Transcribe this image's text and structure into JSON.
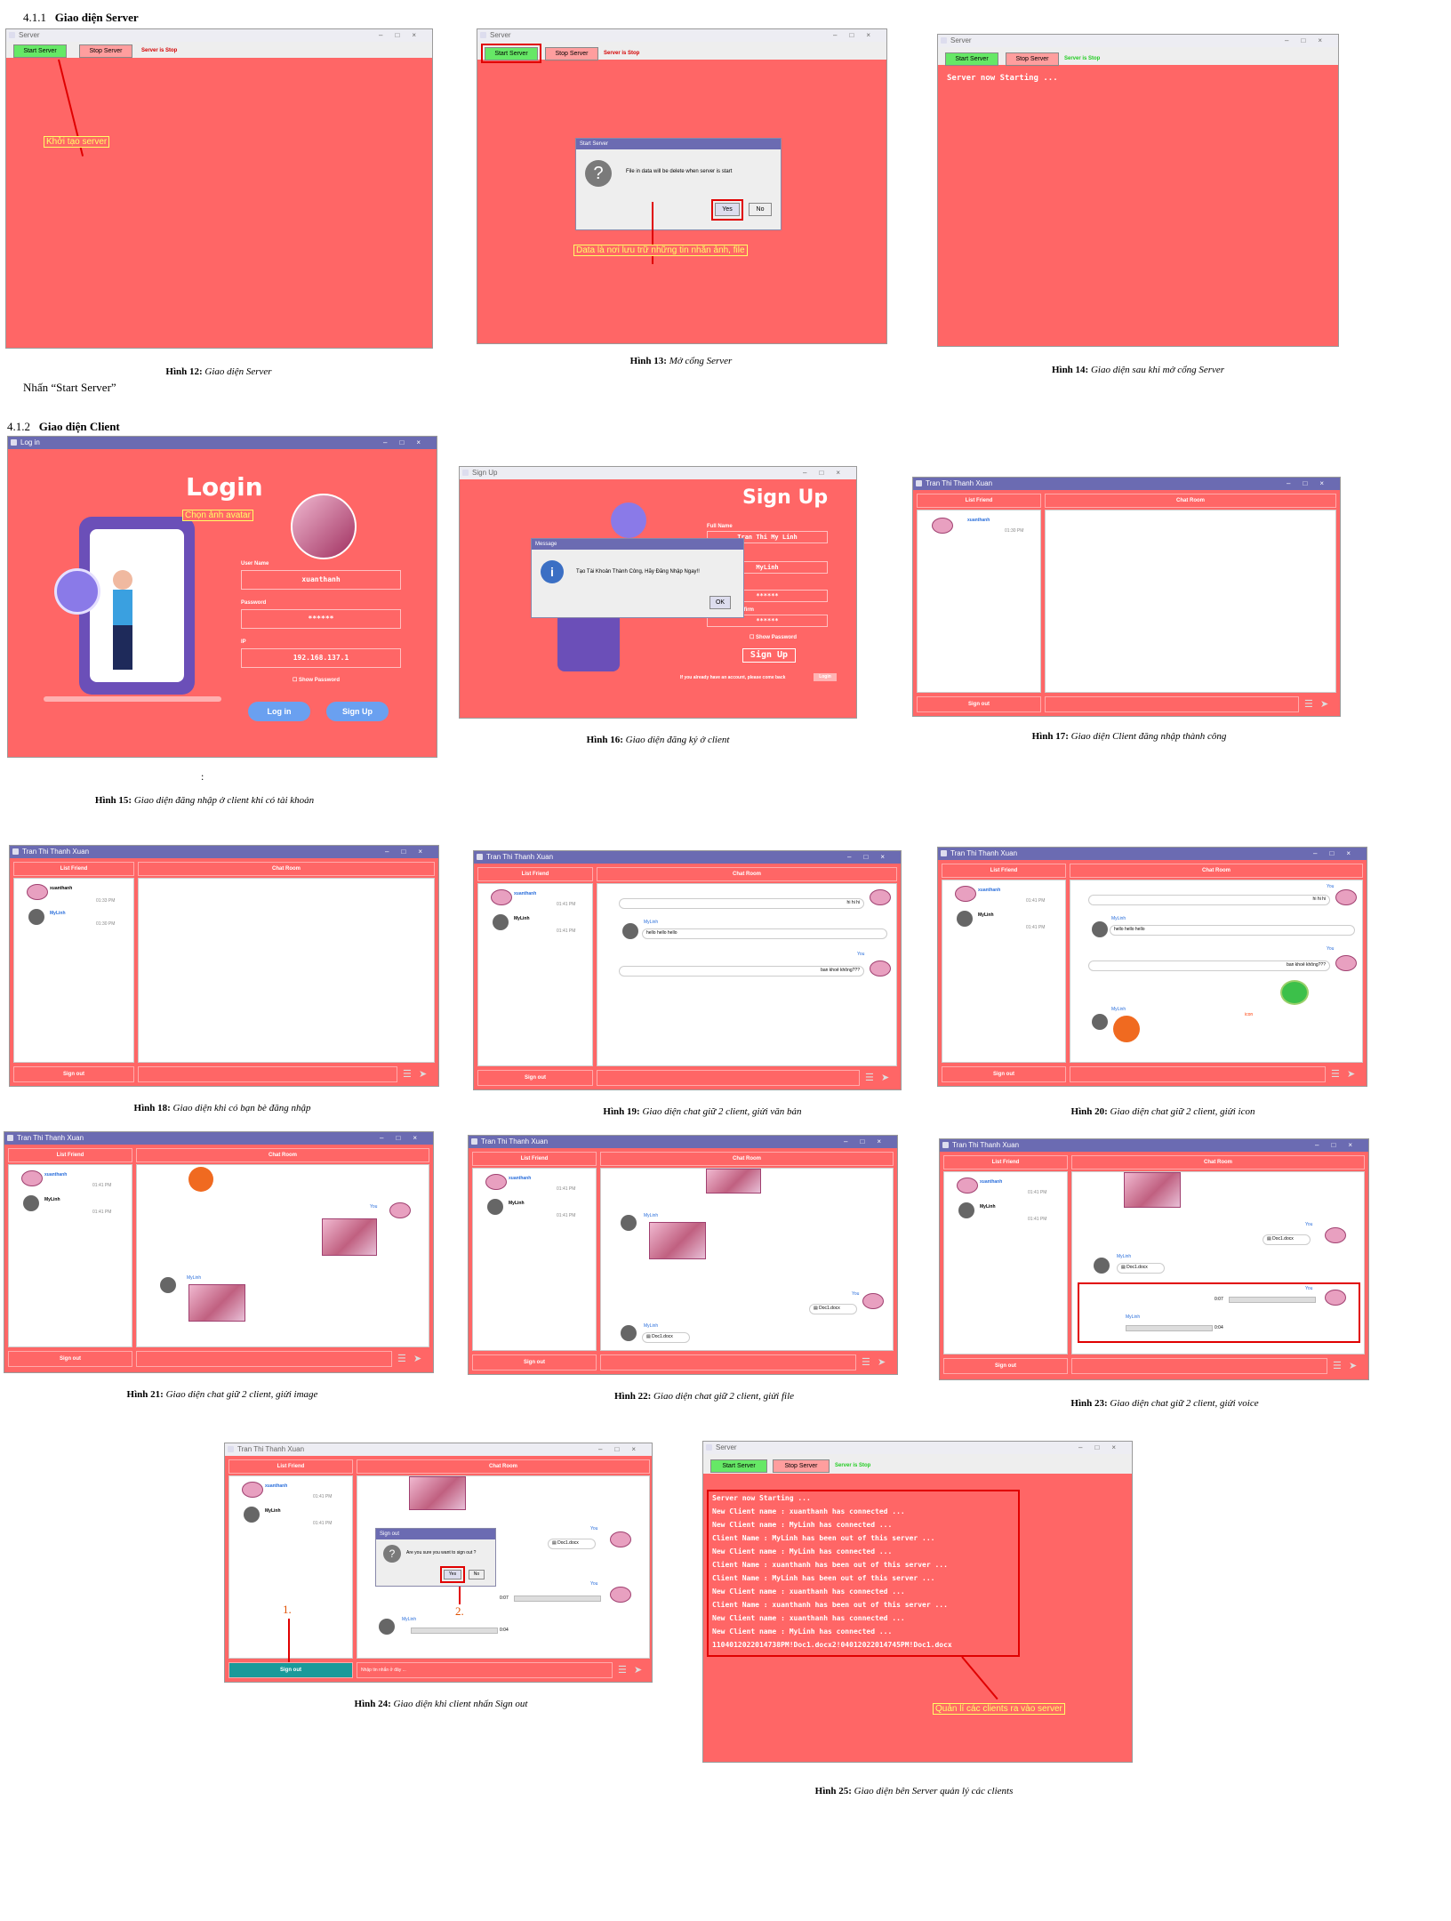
{
  "section_server": {
    "num": "4.1.1",
    "title": "Giao diện Server"
  },
  "section_client": {
    "num": "4.1.2",
    "title": "Giao diện Client"
  },
  "note_start": "Nhấn “Start Server”",
  "colon": ":",
  "captions": {
    "h12": {
      "n": "Hình 12:",
      "t": "Giao diện Server"
    },
    "h13": {
      "n": "Hình 13:",
      "t": "Mở cổng Server"
    },
    "h14": {
      "n": "Hình 14:",
      "t": "Giao diện sau khi mở cổng Server"
    },
    "h15": {
      "n": "Hình 15:",
      "t": "Giao diện đăng nhập ở client khi có tài khoản"
    },
    "h16": {
      "n": "Hình 16:",
      "t": "Giao diện đăng ký ở client"
    },
    "h17": {
      "n": "Hình 17:",
      "t": "Giao diện Client đăng nhập thành công"
    },
    "h18": {
      "n": "Hình 18:",
      "t": "Giao diện khi có bạn bè đăng nhập"
    },
    "h19": {
      "n": "Hình 19:",
      "t": "Giao diện chat giữ 2 client, giửi văn bản"
    },
    "h20": {
      "n": "Hình 20:",
      "t": "Giao diện chat giữ 2 client, giửi icon"
    },
    "h21": {
      "n": "Hình 21:",
      "t": "Giao diện chat giữ 2 client, giửi image"
    },
    "h22": {
      "n": "Hình 22:",
      "t": "Giao diện chat giữ 2 client, giửi file"
    },
    "h23": {
      "n": "Hình 23:",
      "t": "Giao diện chat giữ 2 client, giửi voice"
    },
    "h24": {
      "n": "Hình 24:",
      "t": "Giao diện khi client nhấn Sign out"
    },
    "h25": {
      "n": "Hình 25:",
      "t": "Giao diện bên Server quản lý các clients"
    }
  },
  "server": {
    "title": "Server",
    "start": "Start Server",
    "stop": "Stop Server",
    "status_stop": "Server is Stop",
    "anno_start": "Khởi tạo server",
    "dialog_title": "Start Server",
    "dialog_msg": "File in data will be delete when server is start",
    "yes": "Yes",
    "no": "No",
    "anno_data": "Data là nơi lưu trữ những tin nhắn ảnh, file",
    "starting": "Server now Starting ...",
    "anno_manage": "Quản lí các clients ra vào server",
    "log": [
      "Server now Starting ...",
      "New Client name : xuanthanh has connected ...",
      "New Client name : MyLinh has connected ...",
      "Client Name : MyLinh has been out of this server ...",
      "New Client name : MyLinh has connected ...",
      "Client Name : xuanthanh has been out of this server ...",
      "Client Name : MyLinh has been out of this server ...",
      "New Client name : xuanthanh has connected ...",
      "Client Name : xuanthanh has been out of this server ...",
      "New Client name : xuanthanh has connected ...",
      "New Client name : MyLinh has connected ...",
      "1104012022014738PM!Doc1.docx2!04012022014745PM!Doc1.docx"
    ]
  },
  "login": {
    "title": "Log in",
    "heading": "Login",
    "anno_avatar": "Chọn ảnh avatar",
    "user_label": "User Name",
    "user_value": "xuanthanh",
    "pass_label": "Password",
    "pass_value": "******",
    "ip_label": "IP",
    "ip_value": "192.168.137.1",
    "show_pass": "Show Password",
    "login_btn": "Log in",
    "signup_btn": "Sign Up"
  },
  "signup": {
    "title": "Sign Up",
    "heading": "Sign Up",
    "full_name": "Full Name",
    "full_value": "Tran Thi My Linh",
    "user_value": "MyLinh",
    "pass_value": "******",
    "confirm_label": "Password Confirm",
    "confirm_value": "******",
    "show_pass": "Show Password",
    "btn": "Sign Up",
    "footer": "If you already have an account, please come back",
    "footer_btn": "Login",
    "msg_title": "Message",
    "msg_text": "Tạo Tài Khoản Thành Công, Hãy Đăng Nhập Ngay!!",
    "ok": "OK"
  },
  "chat": {
    "title": "Tran Thi Thanh Xuan",
    "list_friend": "List Friend",
    "chat_room": "Chat Room",
    "sign_out": "Sign out",
    "xuanthanh": "xuanthanh",
    "mylinh": "MyLinh",
    "time1": "01:33 PM",
    "time2": "01:30 PM",
    "time3": "01:41 PM",
    "you": "You",
    "msg1": "hi hi hi",
    "msg2": "hello hello hello",
    "msg3": "ban khoẻ không???",
    "icon_anno": "icon",
    "doc": "Doc1.docx",
    "v1": "0:07",
    "v2": "0:04",
    "signout_title": "Sign out",
    "signout_q": "Are you sure you want to sign out ?",
    "yes": "Yes",
    "no": "No",
    "placeholder": "Nhập tin nhắn ở đây ...",
    "step1": "1.",
    "step2": "2."
  },
  "colors": {
    "bg": "#ff6666",
    "titlebar": "#6b6bb2",
    "green": "#66e866",
    "accent_red": "#e00000"
  }
}
